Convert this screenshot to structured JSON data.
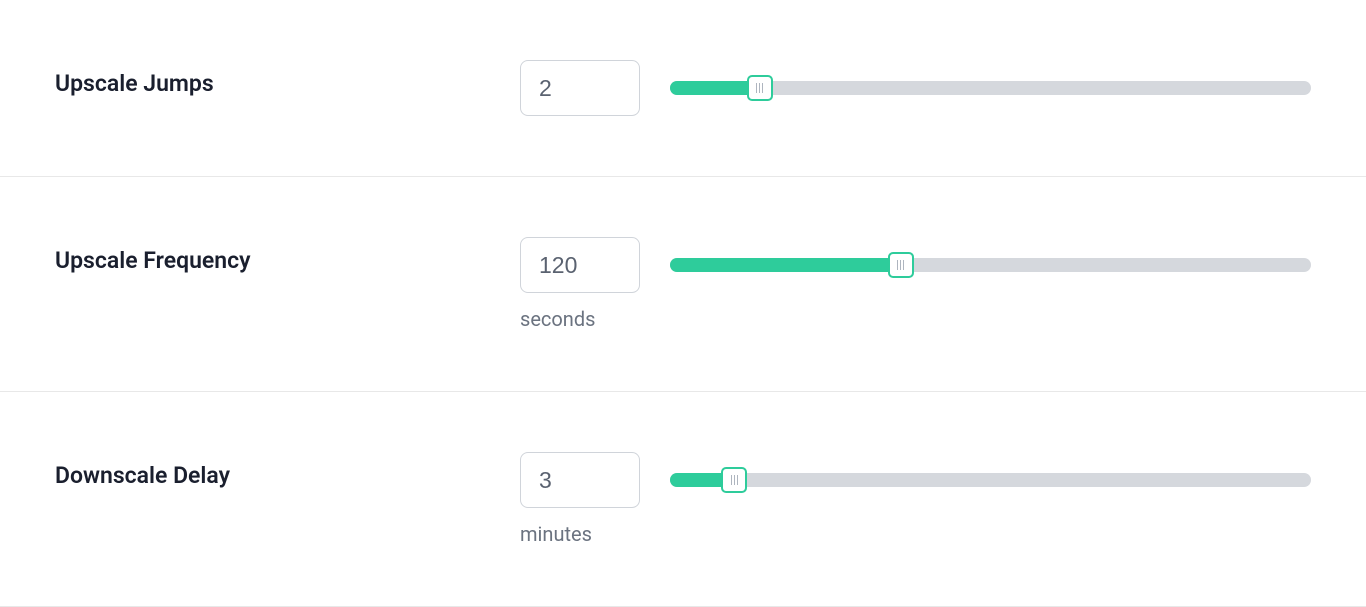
{
  "rows": [
    {
      "label": "Upscale Jumps",
      "value": "2",
      "unit": "",
      "slider_percent": 14
    },
    {
      "label": "Upscale Frequency",
      "value": "120",
      "unit": "seconds",
      "slider_percent": 36
    },
    {
      "label": "Downscale Delay",
      "value": "3",
      "unit": "minutes",
      "slider_percent": 10
    }
  ]
}
